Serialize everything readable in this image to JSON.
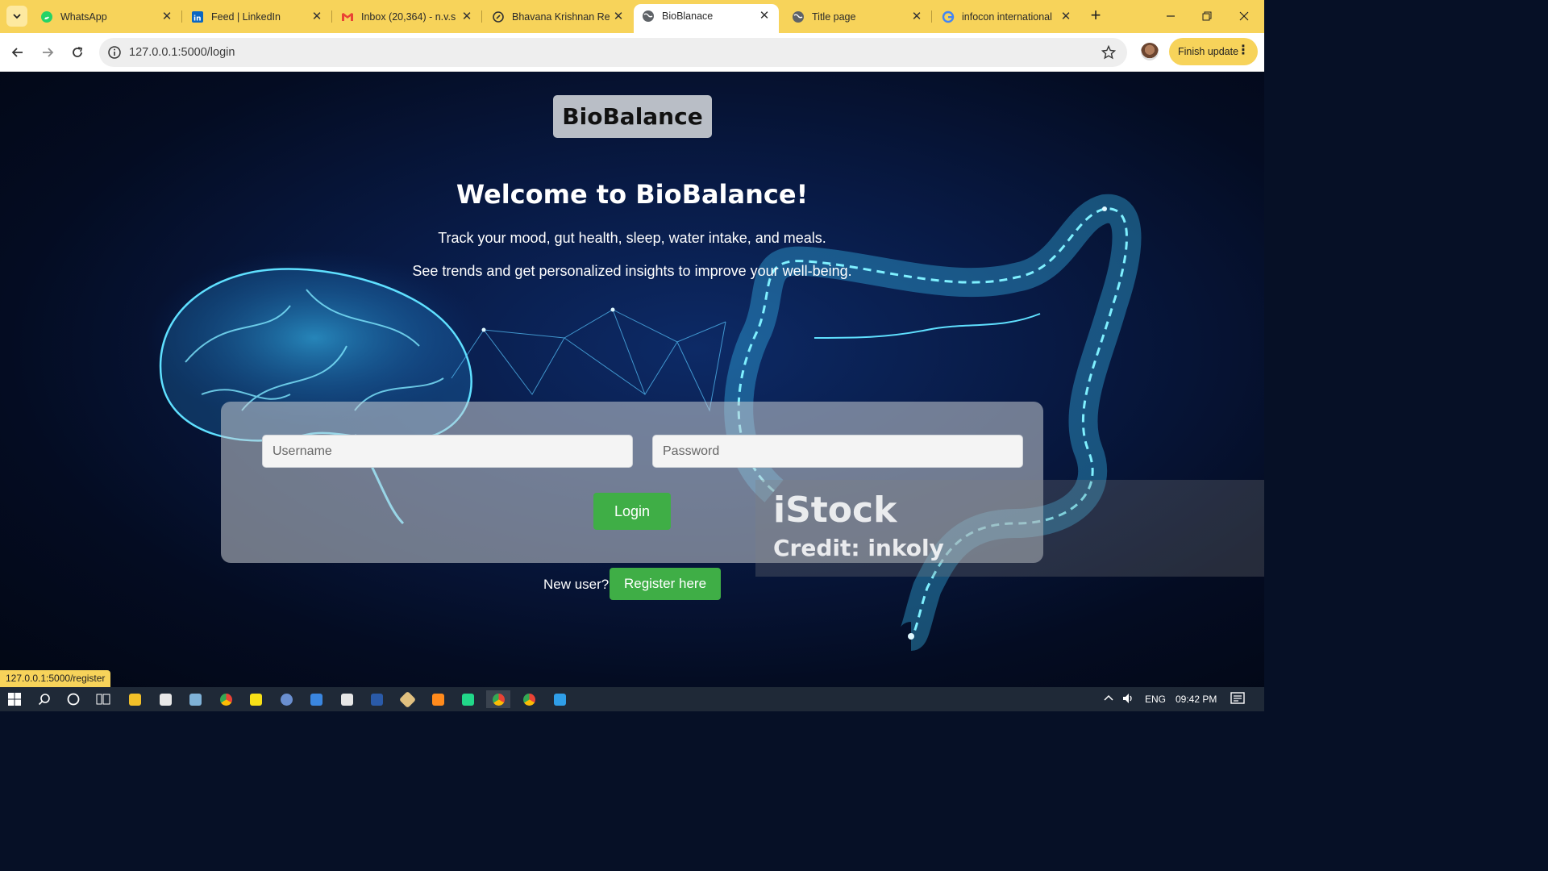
{
  "browser": {
    "tabs": [
      {
        "title": "WhatsApp",
        "icon": "whatsapp-icon",
        "color": "#25d366"
      },
      {
        "title": "Feed | LinkedIn",
        "icon": "linkedin-icon",
        "color": "#0a66c2"
      },
      {
        "title": "Inbox (20,364) - n.v.s",
        "icon": "gmail-icon",
        "color": "#ea4335"
      },
      {
        "title": "Bhavana Krishnan Re",
        "icon": "link-icon",
        "color": "#333333"
      },
      {
        "title": "BioBlanace",
        "icon": "globe-icon",
        "color": "#5f6368",
        "active": true
      },
      {
        "title": "Title page",
        "icon": "globe-icon",
        "color": "#5f6368"
      },
      {
        "title": "infocon international",
        "icon": "google-icon",
        "color": "#4285f4"
      }
    ],
    "url": "127.0.0.1:5000/login",
    "finish_update_label": "Finish update",
    "status_url": "127.0.0.1:5000/register",
    "chrome_color": "#f7d35a"
  },
  "page": {
    "brand": "BioBalance",
    "welcome": "Welcome to BioBalance!",
    "subtitle_1": "Track your mood, gut health, sleep, water intake, and meals.",
    "subtitle_2": "See trends and get personalized insights to improve your well-being.",
    "username_placeholder": "Username",
    "password_placeholder": "Password",
    "login_label": "Login",
    "new_user_text": "New user?",
    "register_label": "Register here",
    "accent_green": "#3fae46",
    "watermark": {
      "logo": "iStock",
      "credit": "Credit: inkoly"
    }
  },
  "taskbar": {
    "language": "ENG",
    "time": "09:42 PM",
    "apps": [
      "file-explorer-icon",
      "store-icon",
      "notepad-icon",
      "chrome-icon",
      "sticky-notes-icon",
      "r-icon",
      "app-icon",
      "files-icon",
      "powershell-icon",
      "git-icon",
      "sublime-icon",
      "pycharm-icon",
      "chrome-icon",
      "chrome-icon",
      "vscode-icon"
    ]
  }
}
